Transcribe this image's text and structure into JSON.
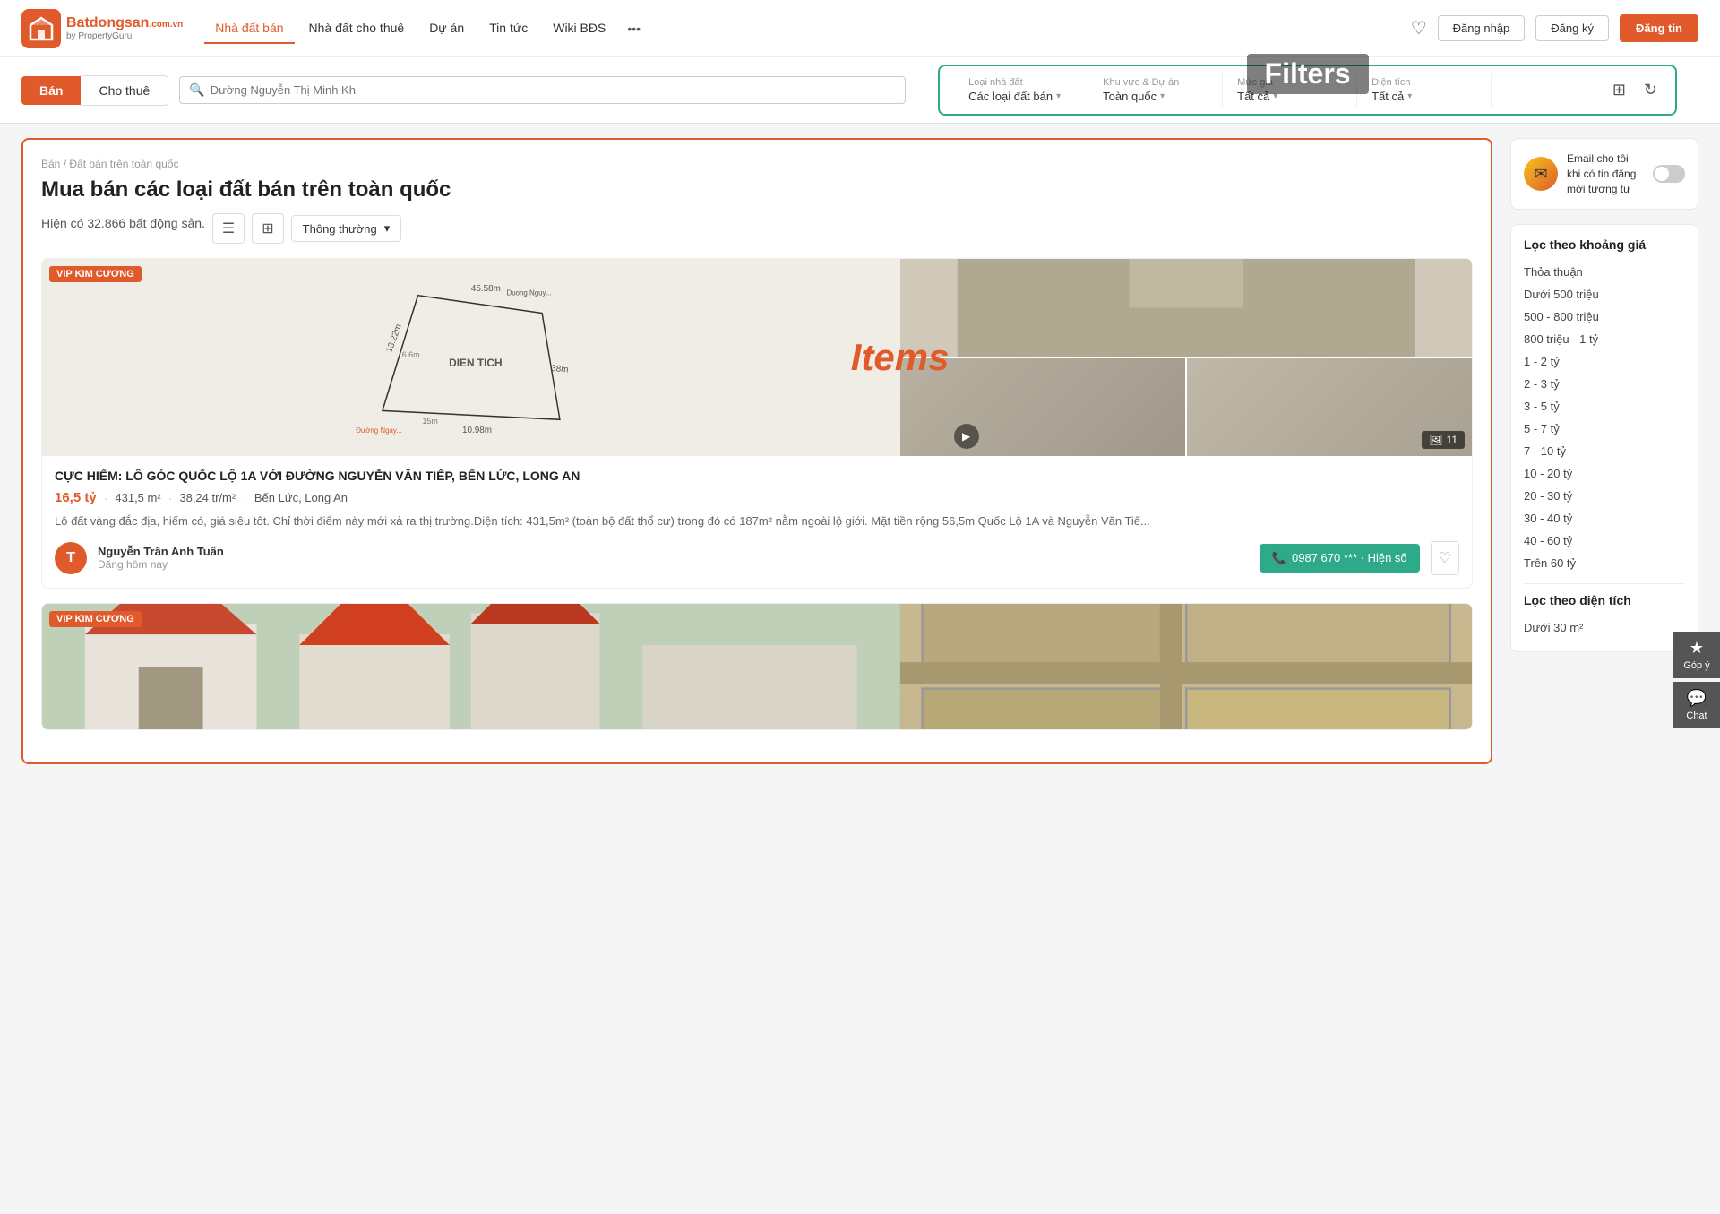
{
  "site": {
    "logo_letter": "B",
    "logo_name": "Batdongsan",
    "logo_com": ".com.vn",
    "logo_sub": "by PropertyGuru"
  },
  "nav": {
    "links": [
      {
        "id": "nha-dat-ban",
        "label": "Nhà đất bán",
        "active": true
      },
      {
        "id": "nha-dat-cho-thue",
        "label": "Nhà đất cho thuê",
        "active": false
      },
      {
        "id": "du-an",
        "label": "Dự án",
        "active": false
      },
      {
        "id": "tin-tuc",
        "label": "Tin tức",
        "active": false
      },
      {
        "id": "wiki-bds",
        "label": "Wiki BĐS",
        "active": false
      },
      {
        "id": "more",
        "label": "•••",
        "active": false
      }
    ],
    "btn_login": "Đăng nhập",
    "btn_register": "Đăng ký",
    "btn_post": "Đăng tin"
  },
  "search_bar": {
    "tab_ban": "Bán",
    "tab_cho_thue": "Cho thuê",
    "placeholder": "Đường Nguyễn Thị Minh Kh"
  },
  "filters": {
    "overlay_label": "Filters",
    "groups": [
      {
        "id": "loai-nha-dat",
        "label": "Loại nhà đất",
        "value": "Các loại đất bán"
      },
      {
        "id": "khu-vuc",
        "label": "Khu vực & Dự án",
        "value": "Toàn quốc"
      },
      {
        "id": "muc-gia",
        "label": "Mức giá",
        "value": "Tất cả"
      },
      {
        "id": "dien-tich",
        "label": "Diện tích",
        "value": "Tất cả"
      }
    ],
    "icon_filter": "⊞",
    "icon_refresh": "↻"
  },
  "main": {
    "breadcrumb": "Bán / Đất bán trên toàn quốc",
    "breadcrumb_parts": [
      "Bán",
      "Đất bán trên toàn quốc"
    ],
    "page_title": "Mua bán các loại đất bán trên toàn quốc",
    "listing_count": "Hiện có 32.866 bất động sản.",
    "sort_label": "Thông thường",
    "items_overlay": "Items",
    "listings": [
      {
        "id": 1,
        "badge": "VIP KIM CƯƠNG",
        "title": "CỰC HIẾM: LÔ GÓC QUỐC LỘ 1A VỚI ĐƯỜNG NGUYỄN VĂN TIẾP, BẾN LỨC, LONG AN",
        "price": "16,5 tỷ",
        "area": "431,5 m²",
        "price_m2": "38,24 tr/m²",
        "location": "Bến Lức, Long An",
        "description": "Lô đất vàng đắc địa, hiếm có, giá siêu tốt. Chỉ thời điểm này mới xả ra thị trường.Diện tích: 431,5m² (toàn bộ đất thổ cư) trong đó có 187m² nằm ngoài lộ giới. Mặt tiền rộng 56,5m Quốc Lộ 1A và Nguyễn Văn Tiế...",
        "poster_initial": "T",
        "poster_name": "Nguyễn Trần Anh Tuấn",
        "poster_time": "Đăng hôm nay",
        "phone": "0987 670 *** · Hiện số",
        "image_count": 11
      },
      {
        "id": 2,
        "badge": "VIP KIM CƯƠNG",
        "title": "",
        "price": "",
        "area": "",
        "price_m2": "",
        "location": "",
        "description": "",
        "poster_initial": "",
        "poster_name": "",
        "poster_time": "",
        "phone": "",
        "image_count": 0
      }
    ]
  },
  "sidebar": {
    "email_alert": {
      "icon": "✉",
      "text": "Email cho tôi khi có tin đăng mới tương tự",
      "toggle_on": false
    },
    "price_filter": {
      "title": "Lọc theo khoảng giá",
      "options": [
        "Thỏa thuận",
        "Dưới 500 triệu",
        "500 - 800 triệu",
        "800 triệu - 1 tỷ",
        "1 - 2 tỷ",
        "2 - 3 tỷ",
        "3 - 5 tỷ",
        "5 - 7 tỷ",
        "7 - 10 tỷ",
        "10 - 20 tỷ",
        "20 - 30 tỷ",
        "30 - 40 tỷ",
        "40 - 60 tỷ",
        "Trên 60 tỷ"
      ]
    },
    "area_filter": {
      "title": "Lọc theo diện tích",
      "options": [
        "Dưới 30 m²"
      ]
    }
  },
  "float_buttons": [
    {
      "id": "gop-y",
      "icon": "★",
      "label": "Góp ý"
    },
    {
      "id": "chat",
      "icon": "💬",
      "label": "Chat"
    }
  ]
}
